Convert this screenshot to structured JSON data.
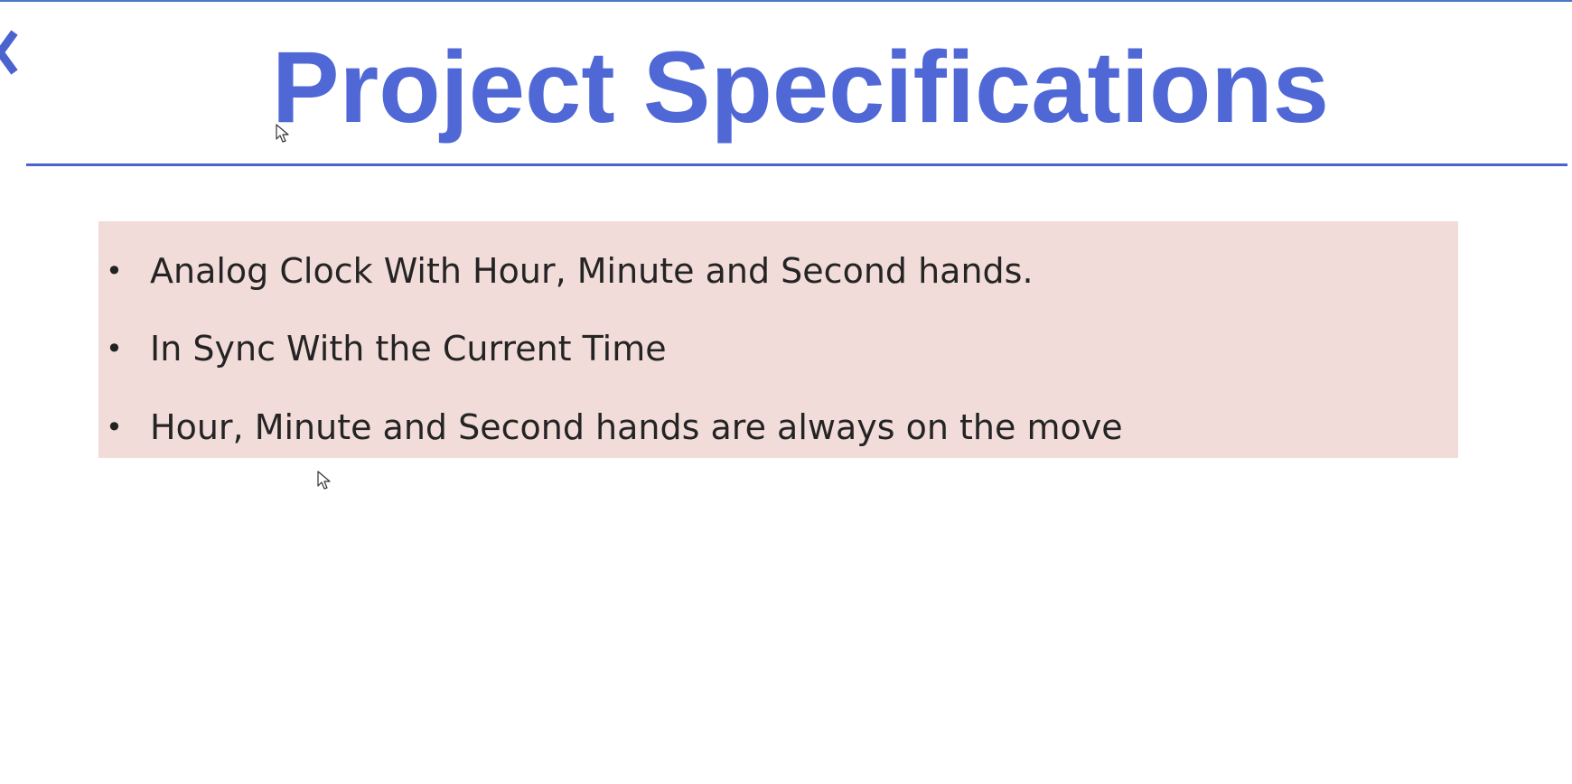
{
  "slide": {
    "title": "Project Specifications",
    "bullets": [
      "Analog Clock With Hour, Minute and Second hands.",
      "In Sync With the Current Time",
      "Hour, Minute and Second hands are always on the move"
    ],
    "bullet_symbol": "•"
  },
  "icons": {
    "back": "chevron-left-icon",
    "cursor": "mouse-pointer-icon"
  },
  "colors": {
    "title": "#5068d6",
    "accent_rule": "#4a63cf",
    "bullet_box_background": "#f2dcd9",
    "text": "#242424"
  }
}
